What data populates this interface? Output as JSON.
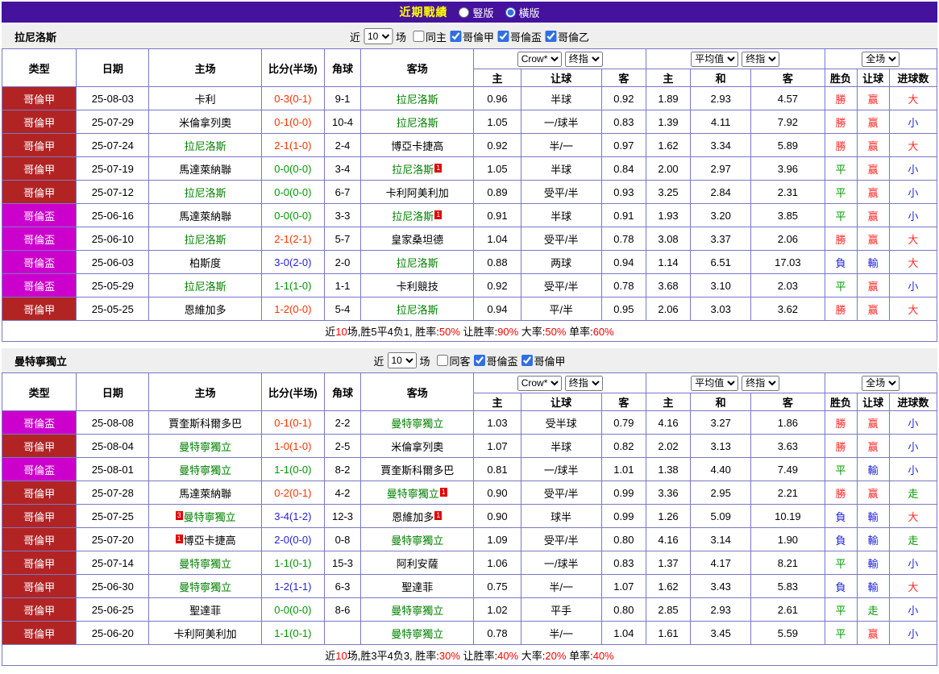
{
  "theme": {
    "titlebar_bg": "#45129E",
    "title_yellow": "#FFFF00",
    "band_bg": "#EFEFEF",
    "border": "#7878C8",
    "league_red": "#B22424",
    "league_magenta": "#CC00CC",
    "focal_green": "#008000",
    "score_win": "#FF3300",
    "score_draw": "#009900",
    "score_loss": "#2323DD",
    "text_red": "#FF2A2A",
    "text_green": "#009900",
    "text_blue": "#2323DD",
    "summary_red": "#FF0000",
    "accent_blue": "#2F6FE4"
  },
  "title_bar": {
    "title": "近期戰績",
    "radios": [
      {
        "label": "豎版",
        "checked": false
      },
      {
        "label": "橫版",
        "checked": true
      }
    ]
  },
  "labels": {
    "near": "近",
    "games_unit": "场"
  },
  "table_header": {
    "type": "类型",
    "date": "日期",
    "home": "主场",
    "score": "比分(半场)",
    "corner": "角球",
    "away": "客场",
    "odds_source_select": "Crow*",
    "odds_stage_select": "终指",
    "avg_source_select": "平均值",
    "avg_stage_select": "终指",
    "scope_select": "全场",
    "sub_home": "主",
    "sub_handicap": "让球",
    "sub_away": "客",
    "sub_avg_home": "主",
    "sub_avg_draw": "和",
    "sub_avg_away": "客",
    "result": "胜负",
    "handicap_result": "让球",
    "goals": "进球数"
  },
  "sections": [
    {
      "team": "拉尼洛斯",
      "games_select": "10",
      "same_checkbox": {
        "label": "同主",
        "checked": false
      },
      "league_checkboxes": [
        {
          "label": "哥倫甲",
          "checked": true
        },
        {
          "label": "哥倫盃",
          "checked": true
        },
        {
          "label": "哥倫乙",
          "checked": true
        }
      ],
      "rows": [
        {
          "league": "哥倫甲",
          "league_color": "red",
          "date": "25-08-03",
          "home": {
            "name": "卡利"
          },
          "score": "0-3(0-1)",
          "result": "win",
          "corner": "9-1",
          "away": {
            "name": "拉尼洛斯",
            "focal": true
          },
          "odds": [
            "0.96",
            "半球",
            "0.92"
          ],
          "avg": [
            "1.89",
            "2.93",
            "4.57"
          ],
          "outcome": {
            "text": "勝",
            "color": "red"
          },
          "handicap": {
            "text": "赢",
            "color": "red"
          },
          "goals": {
            "text": "大",
            "color": "red"
          }
        },
        {
          "league": "哥倫甲",
          "league_color": "red",
          "date": "25-07-29",
          "home": {
            "name": "米倫拿列奧"
          },
          "score": "0-1(0-0)",
          "result": "win",
          "corner": "10-4",
          "away": {
            "name": "拉尼洛斯",
            "focal": true
          },
          "odds": [
            "1.05",
            "一/球半",
            "0.83"
          ],
          "avg": [
            "1.39",
            "4.11",
            "7.92"
          ],
          "outcome": {
            "text": "勝",
            "color": "red"
          },
          "handicap": {
            "text": "赢",
            "color": "red"
          },
          "goals": {
            "text": "小",
            "color": "blue"
          }
        },
        {
          "league": "哥倫甲",
          "league_color": "red",
          "date": "25-07-24",
          "home": {
            "name": "拉尼洛斯",
            "focal": true
          },
          "score": "2-1(1-0)",
          "result": "win",
          "corner": "2-4",
          "away": {
            "name": "博亞卡捷高"
          },
          "odds": [
            "0.92",
            "半/一",
            "0.97"
          ],
          "avg": [
            "1.62",
            "3.34",
            "5.89"
          ],
          "outcome": {
            "text": "勝",
            "color": "red"
          },
          "handicap": {
            "text": "赢",
            "color": "red"
          },
          "goals": {
            "text": "大",
            "color": "red"
          }
        },
        {
          "league": "哥倫甲",
          "league_color": "red",
          "date": "25-07-19",
          "home": {
            "name": "馬達萊納聯"
          },
          "score": "0-0(0-0)",
          "result": "draw",
          "corner": "3-4",
          "away": {
            "name": "拉尼洛斯",
            "focal": true,
            "sup": "1"
          },
          "odds": [
            "1.05",
            "半球",
            "0.84"
          ],
          "avg": [
            "2.00",
            "2.97",
            "3.96"
          ],
          "outcome": {
            "text": "平",
            "color": "green"
          },
          "handicap": {
            "text": "赢",
            "color": "red"
          },
          "goals": {
            "text": "小",
            "color": "blue"
          }
        },
        {
          "league": "哥倫甲",
          "league_color": "red",
          "date": "25-07-12",
          "home": {
            "name": "拉尼洛斯",
            "focal": true
          },
          "score": "0-0(0-0)",
          "result": "draw",
          "corner": "6-7",
          "away": {
            "name": "卡利阿美利加"
          },
          "odds": [
            "0.89",
            "受平/半",
            "0.93"
          ],
          "avg": [
            "3.25",
            "2.84",
            "2.31"
          ],
          "outcome": {
            "text": "平",
            "color": "green"
          },
          "handicap": {
            "text": "赢",
            "color": "red"
          },
          "goals": {
            "text": "小",
            "color": "blue"
          }
        },
        {
          "league": "哥倫盃",
          "league_color": "magenta",
          "date": "25-06-16",
          "home": {
            "name": "馬達萊納聯"
          },
          "score": "0-0(0-0)",
          "result": "draw",
          "corner": "3-3",
          "away": {
            "name": "拉尼洛斯",
            "focal": true,
            "sup": "1"
          },
          "odds": [
            "0.91",
            "半球",
            "0.91"
          ],
          "avg": [
            "1.93",
            "3.20",
            "3.85"
          ],
          "outcome": {
            "text": "平",
            "color": "green"
          },
          "handicap": {
            "text": "赢",
            "color": "red"
          },
          "goals": {
            "text": "小",
            "color": "blue"
          }
        },
        {
          "league": "哥倫盃",
          "league_color": "magenta",
          "date": "25-06-10",
          "home": {
            "name": "拉尼洛斯",
            "focal": true
          },
          "score": "2-1(2-1)",
          "result": "win",
          "corner": "5-7",
          "away": {
            "name": "皇家桑坦德"
          },
          "odds": [
            "1.04",
            "受平/半",
            "0.78"
          ],
          "avg": [
            "3.08",
            "3.37",
            "2.06"
          ],
          "outcome": {
            "text": "勝",
            "color": "red"
          },
          "handicap": {
            "text": "赢",
            "color": "red"
          },
          "goals": {
            "text": "大",
            "color": "red"
          }
        },
        {
          "league": "哥倫盃",
          "league_color": "magenta",
          "date": "25-06-03",
          "home": {
            "name": "柏斯度"
          },
          "score": "3-0(2-0)",
          "result": "loss",
          "corner": "2-0",
          "away": {
            "name": "拉尼洛斯",
            "focal": true
          },
          "odds": [
            "0.88",
            "两球",
            "0.94"
          ],
          "avg": [
            "1.14",
            "6.51",
            "17.03"
          ],
          "outcome": {
            "text": "負",
            "color": "blue"
          },
          "handicap": {
            "text": "輸",
            "color": "blue"
          },
          "goals": {
            "text": "大",
            "color": "red"
          }
        },
        {
          "league": "哥倫盃",
          "league_color": "magenta",
          "date": "25-05-29",
          "home": {
            "name": "拉尼洛斯",
            "focal": true
          },
          "score": "1-1(1-0)",
          "result": "draw",
          "corner": "1-1",
          "away": {
            "name": "卡利競技"
          },
          "odds": [
            "0.92",
            "受平/半",
            "0.78"
          ],
          "avg": [
            "3.68",
            "3.10",
            "2.03"
          ],
          "outcome": {
            "text": "平",
            "color": "green"
          },
          "handicap": {
            "text": "赢",
            "color": "red"
          },
          "goals": {
            "text": "小",
            "color": "blue"
          }
        },
        {
          "league": "哥倫甲",
          "league_color": "red",
          "date": "25-05-25",
          "home": {
            "name": "恩維加多"
          },
          "score": "1-2(0-0)",
          "result": "win",
          "corner": "5-4",
          "away": {
            "name": "拉尼洛斯",
            "focal": true
          },
          "odds": [
            "0.94",
            "平/半",
            "0.95"
          ],
          "avg": [
            "2.06",
            "3.03",
            "3.62"
          ],
          "outcome": {
            "text": "勝",
            "color": "red"
          },
          "handicap": {
            "text": "赢",
            "color": "red"
          },
          "goals": {
            "text": "大",
            "color": "red"
          }
        }
      ],
      "summary": [
        {
          "text": "近"
        },
        {
          "text": "10",
          "color": "red"
        },
        {
          "text": "场,胜5平4负1, 胜率:"
        },
        {
          "text": "50%",
          "color": "red"
        },
        {
          "text": " 让胜率:"
        },
        {
          "text": "90%",
          "color": "red"
        },
        {
          "text": " 大率:"
        },
        {
          "text": "50%",
          "color": "red"
        },
        {
          "text": " 单率:"
        },
        {
          "text": "60%",
          "color": "red"
        }
      ]
    },
    {
      "team": "曼特寧獨立",
      "games_select": "10",
      "same_checkbox": {
        "label": "同客",
        "checked": false
      },
      "league_checkboxes": [
        {
          "label": "哥倫盃",
          "checked": true
        },
        {
          "label": "哥倫甲",
          "checked": true
        }
      ],
      "rows": [
        {
          "league": "哥倫盃",
          "league_color": "magenta",
          "date": "25-08-08",
          "home": {
            "name": "賈奎斯科爾多巴"
          },
          "score": "0-1(0-1)",
          "result": "win",
          "corner": "2-2",
          "away": {
            "name": "曼特寧獨立",
            "focal": true
          },
          "odds": [
            "1.03",
            "受半球",
            "0.79"
          ],
          "avg": [
            "4.16",
            "3.27",
            "1.86"
          ],
          "outcome": {
            "text": "勝",
            "color": "red"
          },
          "handicap": {
            "text": "赢",
            "color": "red"
          },
          "goals": {
            "text": "小",
            "color": "blue"
          }
        },
        {
          "league": "哥倫甲",
          "league_color": "red",
          "date": "25-08-04",
          "home": {
            "name": "曼特寧獨立",
            "focal": true
          },
          "score": "1-0(1-0)",
          "result": "win",
          "corner": "2-5",
          "away": {
            "name": "米倫拿列奧"
          },
          "odds": [
            "1.07",
            "半球",
            "0.82"
          ],
          "avg": [
            "2.02",
            "3.13",
            "3.63"
          ],
          "outcome": {
            "text": "勝",
            "color": "red"
          },
          "handicap": {
            "text": "赢",
            "color": "red"
          },
          "goals": {
            "text": "小",
            "color": "blue"
          }
        },
        {
          "league": "哥倫盃",
          "league_color": "magenta",
          "date": "25-08-01",
          "home": {
            "name": "曼特寧獨立",
            "focal": true
          },
          "score": "1-1(0-0)",
          "result": "draw",
          "corner": "8-2",
          "away": {
            "name": "賈奎斯科爾多巴"
          },
          "odds": [
            "0.81",
            "一/球半",
            "1.01"
          ],
          "avg": [
            "1.38",
            "4.40",
            "7.49"
          ],
          "outcome": {
            "text": "平",
            "color": "green"
          },
          "handicap": {
            "text": "輸",
            "color": "blue"
          },
          "goals": {
            "text": "小",
            "color": "blue"
          }
        },
        {
          "league": "哥倫甲",
          "league_color": "red",
          "date": "25-07-28",
          "home": {
            "name": "馬達萊納聯"
          },
          "score": "0-2(0-1)",
          "result": "win",
          "corner": "4-2",
          "away": {
            "name": "曼特寧獨立",
            "focal": true,
            "sup": "1"
          },
          "odds": [
            "0.90",
            "受平/半",
            "0.99"
          ],
          "avg": [
            "3.36",
            "2.95",
            "2.21"
          ],
          "outcome": {
            "text": "勝",
            "color": "red"
          },
          "handicap": {
            "text": "赢",
            "color": "red"
          },
          "goals": {
            "text": "走",
            "color": "green"
          }
        },
        {
          "league": "哥倫甲",
          "league_color": "red",
          "date": "25-07-25",
          "home": {
            "name": "曼特寧獨立",
            "focal": true,
            "pre": "3"
          },
          "score": "3-4(1-2)",
          "result": "loss",
          "corner": "12-3",
          "away": {
            "name": "恩維加多",
            "sup": "1"
          },
          "odds": [
            "0.90",
            "球半",
            "0.99"
          ],
          "avg": [
            "1.26",
            "5.09",
            "10.19"
          ],
          "outcome": {
            "text": "負",
            "color": "blue"
          },
          "handicap": {
            "text": "輸",
            "color": "blue"
          },
          "goals": {
            "text": "大",
            "color": "red"
          }
        },
        {
          "league": "哥倫甲",
          "league_color": "red",
          "date": "25-07-20",
          "home": {
            "name": "博亞卡捷高",
            "pre": "1"
          },
          "score": "2-0(0-0)",
          "result": "loss",
          "corner": "0-8",
          "away": {
            "name": "曼特寧獨立",
            "focal": true
          },
          "odds": [
            "1.09",
            "受平/半",
            "0.80"
          ],
          "avg": [
            "4.16",
            "3.14",
            "1.90"
          ],
          "outcome": {
            "text": "負",
            "color": "blue"
          },
          "handicap": {
            "text": "輸",
            "color": "blue"
          },
          "goals": {
            "text": "走",
            "color": "green"
          }
        },
        {
          "league": "哥倫甲",
          "league_color": "red",
          "date": "25-07-14",
          "home": {
            "name": "曼特寧獨立",
            "focal": true
          },
          "score": "1-1(0-1)",
          "result": "draw",
          "corner": "15-3",
          "away": {
            "name": "阿利安薩"
          },
          "odds": [
            "1.06",
            "一/球半",
            "0.83"
          ],
          "avg": [
            "1.37",
            "4.17",
            "8.21"
          ],
          "outcome": {
            "text": "平",
            "color": "green"
          },
          "handicap": {
            "text": "輸",
            "color": "blue"
          },
          "goals": {
            "text": "小",
            "color": "blue"
          }
        },
        {
          "league": "哥倫甲",
          "league_color": "red",
          "date": "25-06-30",
          "home": {
            "name": "曼特寧獨立",
            "focal": true
          },
          "score": "1-2(1-1)",
          "result": "loss",
          "corner": "6-3",
          "away": {
            "name": "聖達菲"
          },
          "odds": [
            "0.75",
            "半/一",
            "1.07"
          ],
          "avg": [
            "1.62",
            "3.43",
            "5.83"
          ],
          "outcome": {
            "text": "負",
            "color": "blue"
          },
          "handicap": {
            "text": "輸",
            "color": "blue"
          },
          "goals": {
            "text": "大",
            "color": "red"
          }
        },
        {
          "league": "哥倫甲",
          "league_color": "red",
          "date": "25-06-25",
          "home": {
            "name": "聖達菲"
          },
          "score": "0-0(0-0)",
          "result": "draw",
          "corner": "8-6",
          "away": {
            "name": "曼特寧獨立",
            "focal": true
          },
          "odds": [
            "1.02",
            "平手",
            "0.80"
          ],
          "avg": [
            "2.85",
            "2.93",
            "2.61"
          ],
          "outcome": {
            "text": "平",
            "color": "green"
          },
          "handicap": {
            "text": "走",
            "color": "green"
          },
          "goals": {
            "text": "小",
            "color": "blue"
          }
        },
        {
          "league": "哥倫甲",
          "league_color": "red",
          "date": "25-06-20",
          "home": {
            "name": "卡利阿美利加"
          },
          "score": "1-1(0-1)",
          "result": "draw",
          "corner": "",
          "away": {
            "name": "曼特寧獨立",
            "focal": true
          },
          "odds": [
            "0.78",
            "半/一",
            "1.04"
          ],
          "avg": [
            "1.61",
            "3.45",
            "5.59"
          ],
          "outcome": {
            "text": "平",
            "color": "green"
          },
          "handicap": {
            "text": "赢",
            "color": "red"
          },
          "goals": {
            "text": "小",
            "color": "blue"
          }
        }
      ],
      "summary": [
        {
          "text": "近"
        },
        {
          "text": "10",
          "color": "red"
        },
        {
          "text": "场,胜3平4负3, 胜率:"
        },
        {
          "text": "30%",
          "color": "red"
        },
        {
          "text": " 让胜率:"
        },
        {
          "text": "40%",
          "color": "red"
        },
        {
          "text": " 大率:"
        },
        {
          "text": "20%",
          "color": "red"
        },
        {
          "text": " 单率:"
        },
        {
          "text": "40%",
          "color": "red"
        }
      ]
    }
  ]
}
